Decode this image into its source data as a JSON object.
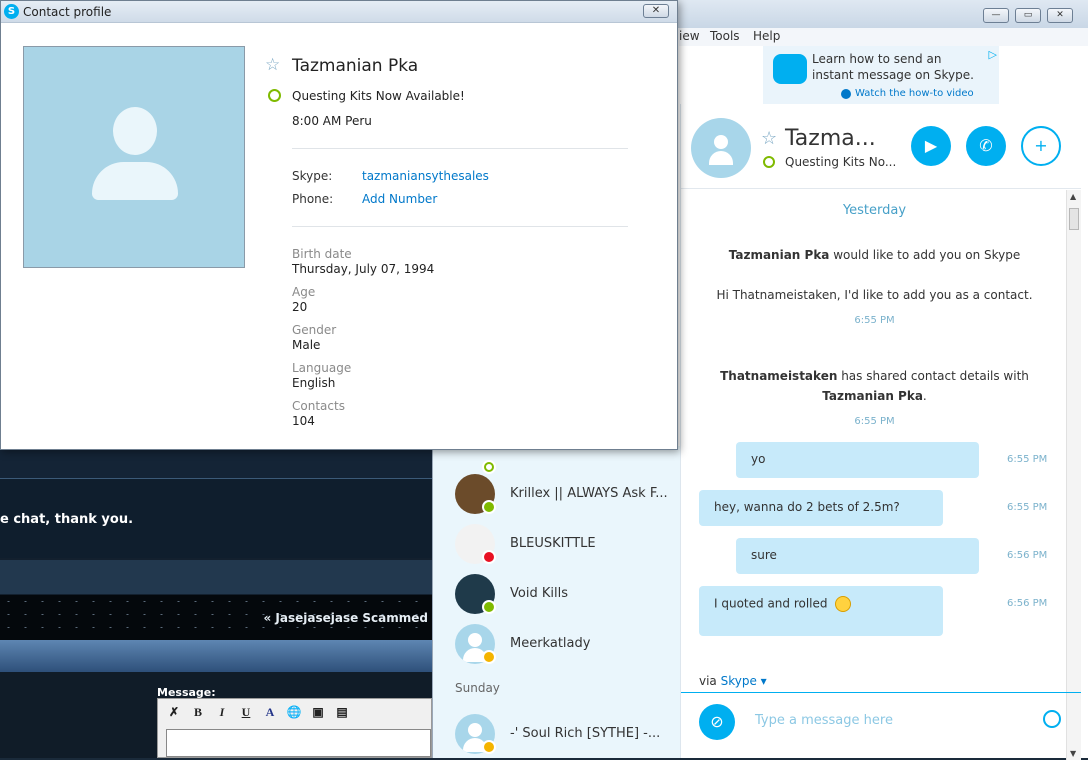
{
  "forum": {
    "notice_text": "e chat, thank you.",
    "scammed_text": "« Jasejasejase Scammed",
    "message_label": "Message:",
    "toolbar": [
      "B",
      "I",
      "U",
      "A"
    ]
  },
  "skype": {
    "menu": [
      "iew",
      "Tools",
      "Help"
    ],
    "window_buttons": [
      "—",
      "▭",
      "✕"
    ],
    "ad": {
      "line1": "Learn how to send an",
      "line2": "instant message on Skype.",
      "link": "Watch the how-to video"
    },
    "contacts": [
      {
        "name": "Krillex || ALWAYS Ask F...",
        "status": "online",
        "status_color": "#7fba00"
      },
      {
        "name": "BLEUSKITTLE",
        "status": "busy",
        "status_color": "#e81123"
      },
      {
        "name": "Void Kills",
        "status": "online",
        "status_color": "#7fba00"
      },
      {
        "name": "Meerkatlady",
        "status": "away",
        "status_color": "#f4b400"
      }
    ],
    "sunday_label": "Sunday",
    "sunday_contact": {
      "name": "-'     Soul Rich [SYTHE] -...",
      "status": "away",
      "status_color": "#f4b400"
    },
    "chat": {
      "header_name": "Tazma...",
      "header_mood": "Questing Kits No...",
      "day_label": "Yesterday",
      "request_name": "Tazmanian Pka",
      "request_rest": " would like to add you on Skype",
      "request_msg": "Hi Thatnameistaken, I'd like to add you as a contact.",
      "request_time": "6:55 PM",
      "shared_name": "Thatnameistaken",
      "shared_rest": " has shared contact details with",
      "shared_contact": "Tazmanian Pka",
      "shared_period": ".",
      "shared_time": "6:55 PM",
      "messages": [
        {
          "text": "yo",
          "time": "6:55 PM"
        },
        {
          "text": "hey, wanna do 2 bets of 2.5m?",
          "time": "6:55 PM"
        },
        {
          "text": "sure",
          "time": "6:56 PM"
        },
        {
          "text": "I quoted and rolled",
          "time": "6:56 PM"
        }
      ],
      "via_prefix": "via ",
      "via_link": "Skype ▾",
      "compose_placeholder": "Type a message here"
    }
  },
  "profile": {
    "title": "Contact profile",
    "close": "✕",
    "name": "Tazmanian Pka",
    "mood": "Questing Kits Now Available!",
    "local_time": "8:00 AM Peru",
    "skype_label": "Skype:",
    "skype_value": "tazmaniansythesales",
    "phone_label": "Phone:",
    "phone_value": "Add Number",
    "birth_label": "Birth date",
    "birth_value": "Thursday, July 07, 1994",
    "age_label": "Age",
    "age_value": "20",
    "gender_label": "Gender",
    "gender_value": "Male",
    "language_label": "Language",
    "language_value": "English",
    "contacts_label": "Contacts",
    "contacts_value": "104"
  }
}
